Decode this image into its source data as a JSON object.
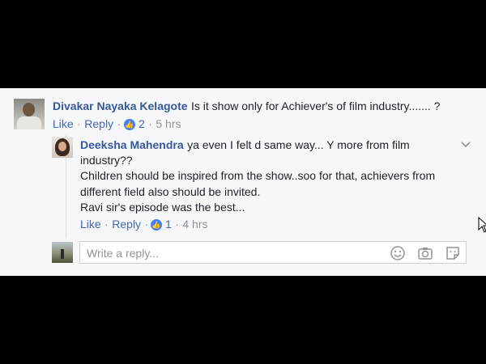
{
  "comment": {
    "author": "Divakar Nayaka Kelagote",
    "text": "Is it show only for Achiever's of film industry....... ?",
    "like_label": "Like",
    "reply_label": "Reply",
    "like_count": "2",
    "time": "5 hrs"
  },
  "reply": {
    "author": "Deeksha Mahendra",
    "text_line1": "ya even I felt d same way... Y more from film",
    "text_line2": "industry??",
    "text_line3": "Children should be inspired from the show..soo for that, achievers from",
    "text_line4": "different field also should be invited.",
    "text_line5": "Ravi sir's episode was the best...",
    "like_label": "Like",
    "reply_label": "Reply",
    "like_count": "1",
    "time": "4 hrs"
  },
  "reply_box": {
    "placeholder": "Write a reply..."
  },
  "separator": "·",
  "colors": {
    "background": "#000000",
    "panel": "#f6f7f9",
    "name": "#365899",
    "action": "#4267b2",
    "meta": "#90949c",
    "like_badge": "#4080ff"
  },
  "icons": [
    "thumbs-up-icon",
    "chevron-down-icon",
    "emoji-icon",
    "camera-icon",
    "sticker-icon",
    "mouse-cursor-icon"
  ]
}
